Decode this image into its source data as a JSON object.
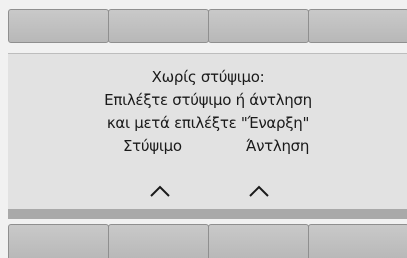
{
  "message": {
    "line1": "Χωρίς στύψιμο:",
    "line2": "Επιλέξτε στύψιμο ή άντληση",
    "line3": "και μετά επιλέξτε \"Έναρξη\""
  },
  "options": {
    "spin": {
      "label": "Στύψιμο",
      "arrow_icon": "chevron-up-icon"
    },
    "drain": {
      "label": "Άντληση",
      "arrow_icon": "chevron-up-icon"
    }
  },
  "colors": {
    "background": "#f1f1f1",
    "panel": "#e2e2e2",
    "softkey": "#c0c0c0",
    "text": "#1a1a1a"
  }
}
